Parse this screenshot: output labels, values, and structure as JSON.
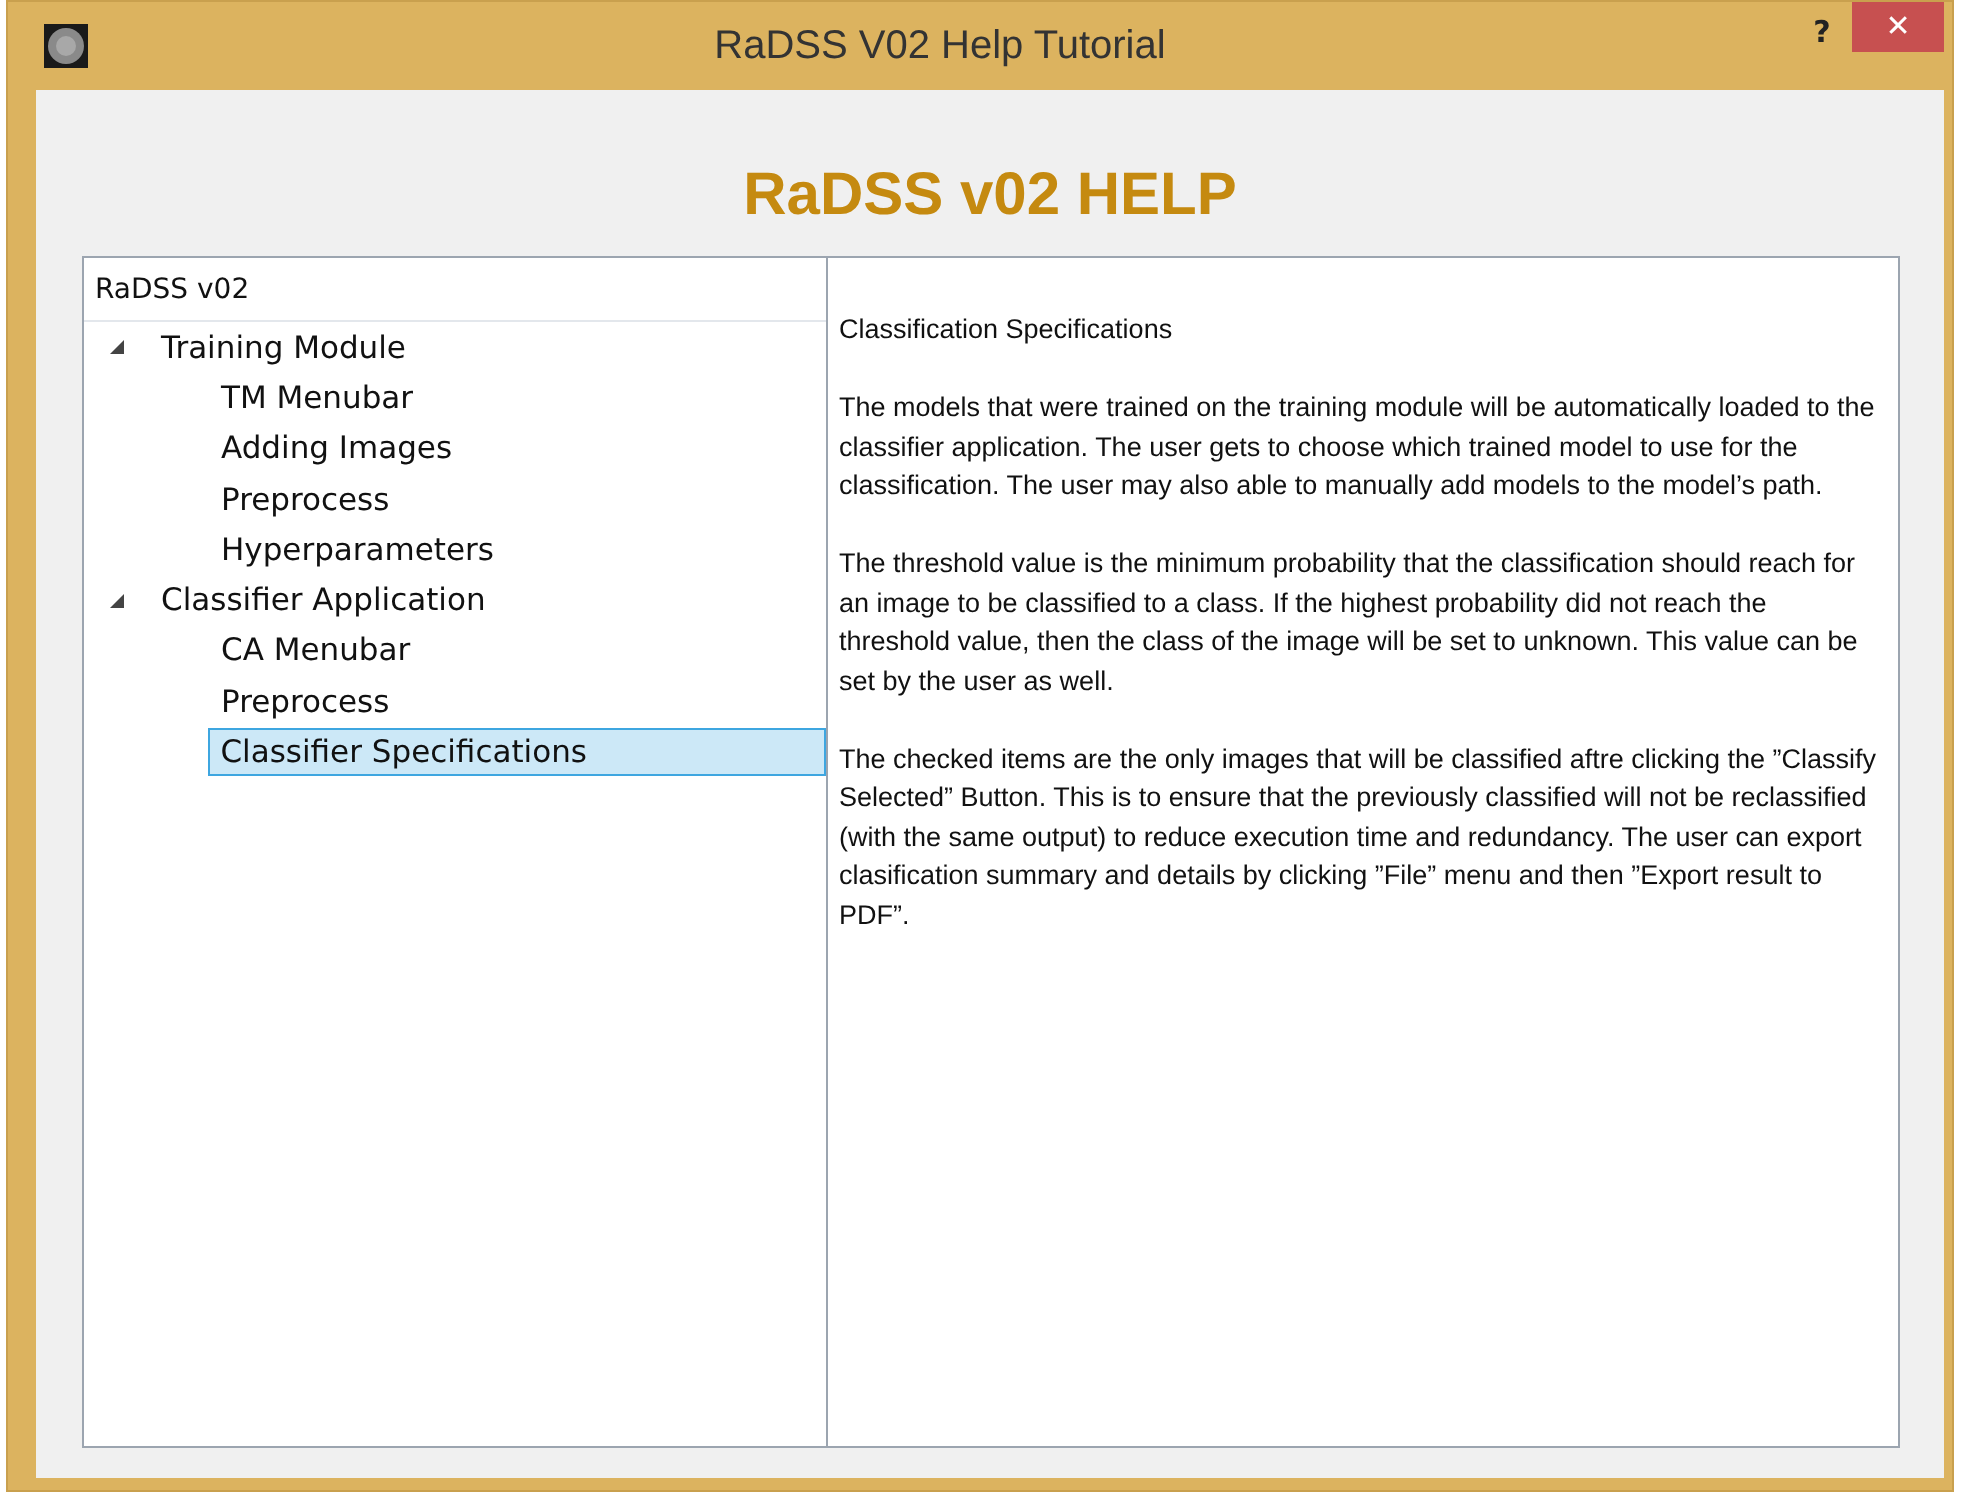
{
  "window": {
    "title": "RaDSS V02 Help Tutorial",
    "help_button": "?",
    "close_button": "✕"
  },
  "heading": "RaDSS v02 HELP",
  "tree": {
    "label": "RaDSS v02",
    "children": [
      {
        "label": "Training Module",
        "expanded": true,
        "selected": false,
        "children": [
          {
            "label": "TM Menubar",
            "selected": false
          },
          {
            "label": "Adding Images",
            "selected": false
          },
          {
            "label": "Preprocess",
            "selected": false
          },
          {
            "label": "Hyperparameters",
            "selected": false
          }
        ]
      },
      {
        "label": "Classifier Application",
        "expanded": true,
        "selected": false,
        "children": [
          {
            "label": "CA Menubar",
            "selected": false
          },
          {
            "label": "Preprocess",
            "selected": false
          },
          {
            "label": "Classifier Specifications",
            "selected": true
          }
        ]
      }
    ]
  },
  "content": {
    "title": "Classification Specifications",
    "paragraphs": [
      "The models that were trained on the training module will be automatically loaded to the classifier application. The user gets to choose which trained model to use for the classification. The user may also able to manually add models to the model’s path.",
      "The threshold value is the minimum probability that the classification should reach for an image to be classified to a class. If the highest probability did not reach the threshold value, then the class of the image will be set to unknown. This value can be set by the user as well.",
      "The checked items are the only images that will be classified aftre clicking the ”Classify Selected” Button. This is to ensure that the previously classified will not be reclassified (with the same output) to reduce execution time and redundancy. The user can export clasification summary and details by clicking ”File” menu and then ”Export result to PDF”."
    ]
  }
}
